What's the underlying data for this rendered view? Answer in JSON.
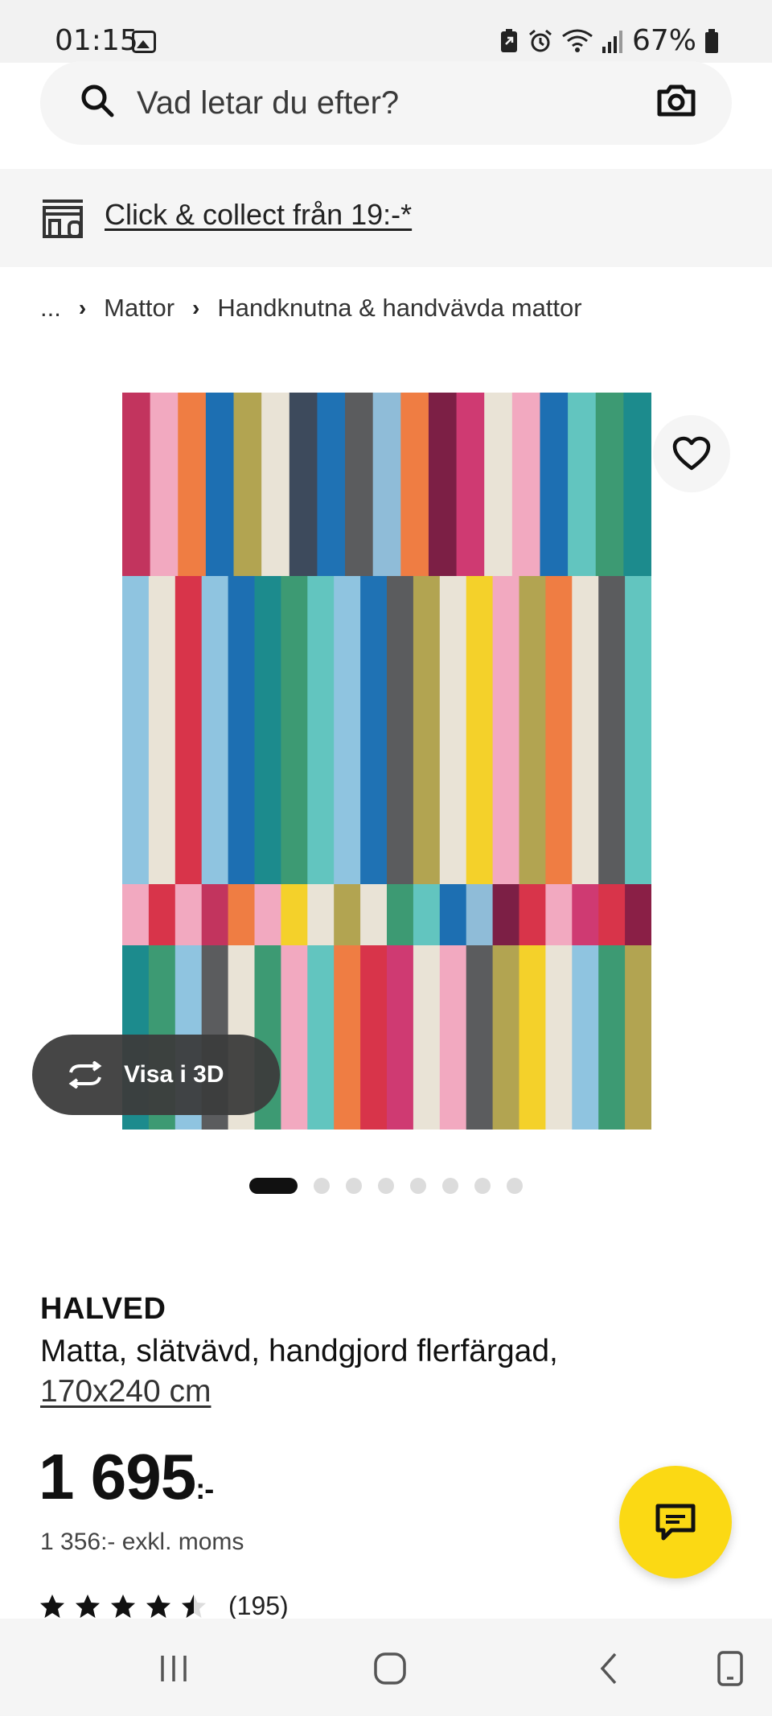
{
  "status_bar": {
    "time": "01:15",
    "battery": "67%"
  },
  "search": {
    "placeholder": "Vad letar du efter?"
  },
  "click_collect": {
    "label": "Click & collect från 19:-*"
  },
  "breadcrumb": {
    "ellipsis": "...",
    "items": [
      "Mattor",
      "Handknutna & handvävda mattor"
    ]
  },
  "product": {
    "view_3d_label": "Visa i 3D",
    "image_count": 8,
    "active_image": 1,
    "brand": "HALVED",
    "description": "Matta, slätvävd, handgjord flerfärgad,",
    "size": "170x240 cm",
    "price_main": "1 695",
    "price_suffix": ":-",
    "price_ex_vat": "1 356:- exkl. moms",
    "rating_value": 4.5,
    "rating_max": 5,
    "rating_count": "(195)"
  },
  "colors": {
    "accent_yellow": "#fbd914",
    "rug_top": [
      "#c2345e",
      "#f2a9c0",
      "#ef7d43",
      "#1d6fb2",
      "#b2a451",
      "#e9e3d6",
      "#3d4a5c",
      "#1f72b4",
      "#5b5c5e",
      "#8fbcd8",
      "#ef7d43",
      "#7c1f45",
      "#cf3a72",
      "#e9e3d6",
      "#f2a9c0",
      "#1d6fb2",
      "#62c5bf",
      "#3d9a73",
      "#1c8b8d"
    ],
    "rug_middle": [
      "#8fc4e0",
      "#e9e3d6",
      "#d8344a",
      "#8fc4e0",
      "#1d6fb2",
      "#1c8b8d",
      "#3d9a73",
      "#62c5bf",
      "#8fc4e0",
      "#1f72b4",
      "#5b5c5e",
      "#b2a451",
      "#e9e3d6",
      "#f4d12a",
      "#f2a9c0",
      "#b2a451",
      "#ef7d43",
      "#e9e3d6",
      "#5b5c5e",
      "#62c5bf"
    ],
    "rug_band": [
      "#f2a9c0",
      "#d8344a",
      "#f2a9c0",
      "#c2345e",
      "#ef7d43",
      "#f2a9c0",
      "#f4d12a",
      "#e9e3d6",
      "#b2a451",
      "#e9e3d6",
      "#3d9a73",
      "#62c5bf",
      "#1d6fb2",
      "#8fbcd8",
      "#7c1f45",
      "#d8344a",
      "#f2a9c0",
      "#cf3a72",
      "#d8344a",
      "#8a1f46"
    ],
    "rug_bottom": [
      "#1c8b8d",
      "#3d9a73",
      "#8fc4e0",
      "#5b5c5e",
      "#e9e3d6",
      "#3d9a73",
      "#f2a9c0",
      "#62c5bf",
      "#ef7d43",
      "#d8344a",
      "#cf3a72",
      "#e9e3d6",
      "#f2a9c0",
      "#5b5c5e",
      "#b2a451",
      "#f4d12a",
      "#e9e3d6",
      "#8fc4e0",
      "#3d9a73",
      "#b2a451"
    ]
  }
}
